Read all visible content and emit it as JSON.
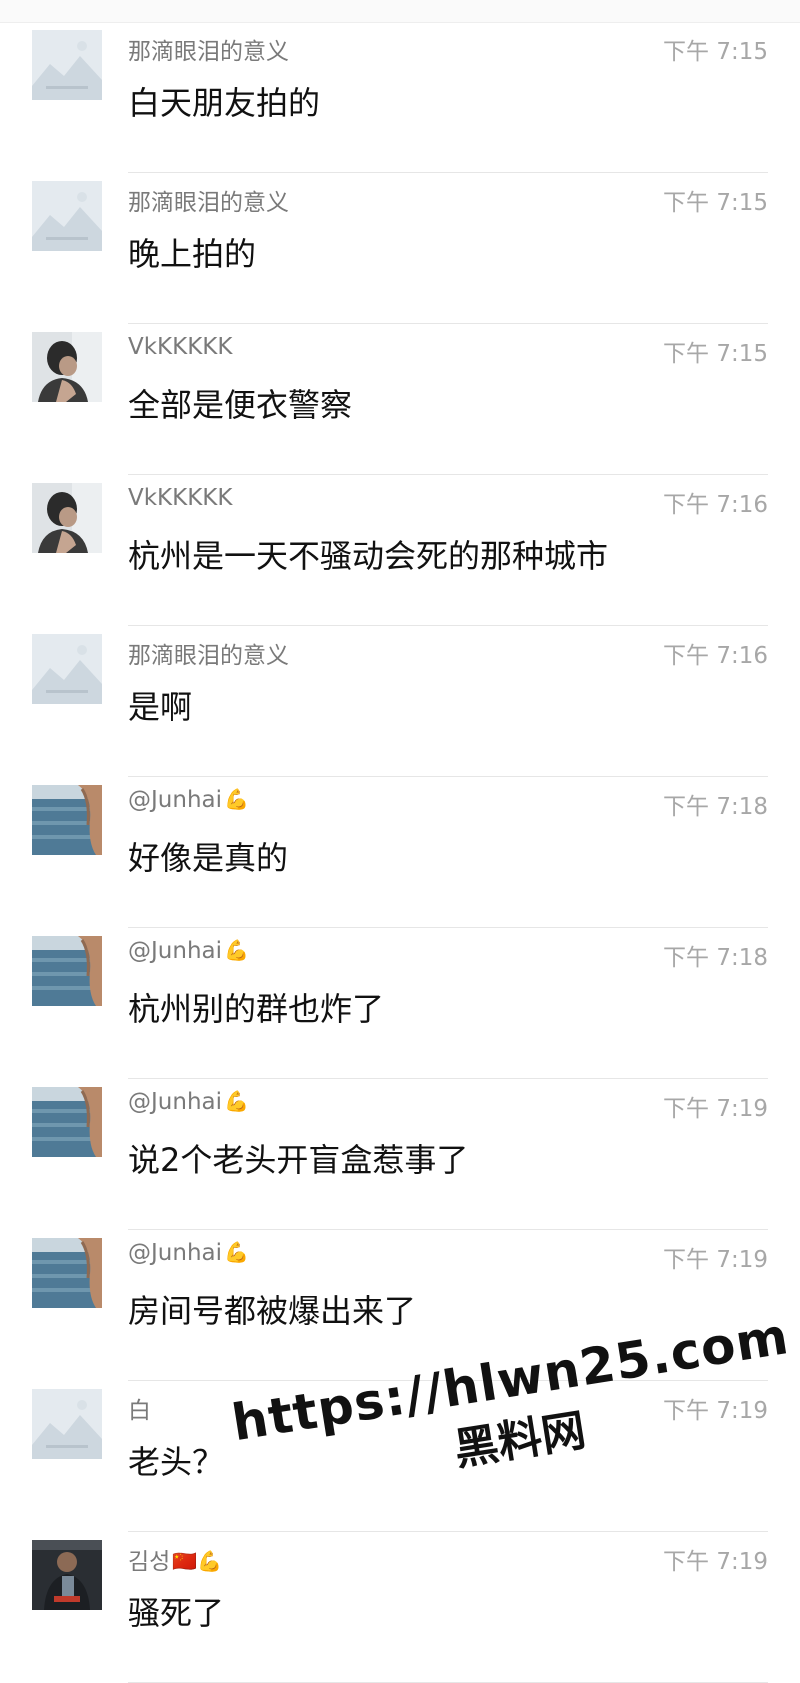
{
  "messages": [
    {
      "sender": "那滴眼泪的意义",
      "badge": "",
      "time": "下午 7:15",
      "text": "白天朋友拍的",
      "avatar": "placeholder-image"
    },
    {
      "sender": "那滴眼泪的意义",
      "badge": "",
      "time": "下午 7:15",
      "text": "晚上拍的",
      "avatar": "placeholder-image"
    },
    {
      "sender": "VkKKKKK",
      "badge": "",
      "time": "下午 7:15",
      "text": "全部是便衣警察",
      "avatar": "person-photo"
    },
    {
      "sender": "VkKKKKK",
      "badge": "",
      "time": "下午 7:16",
      "text": "杭州是一天不骚动会死的那种城市",
      "avatar": "person-photo"
    },
    {
      "sender": "那滴眼泪的意义",
      "badge": "",
      "time": "下午 7:16",
      "text": "是啊",
      "avatar": "placeholder-image"
    },
    {
      "sender": "@Junhai",
      "badge": "💪",
      "time": "下午 7:18",
      "text": "好像是真的",
      "avatar": "sea-photo"
    },
    {
      "sender": "@Junhai",
      "badge": "💪",
      "time": "下午 7:18",
      "text": "杭州别的群也炸了",
      "avatar": "sea-photo"
    },
    {
      "sender": "@Junhai",
      "badge": "💪",
      "time": "下午 7:19",
      "text": "说2个老头开盲盒惹事了",
      "avatar": "sea-photo"
    },
    {
      "sender": "@Junhai",
      "badge": "💪",
      "time": "下午 7:19",
      "text": "房间号都被爆出来了",
      "avatar": "sea-photo"
    },
    {
      "sender": "白",
      "badge": "",
      "time": "下午 7:19",
      "text": "老头？",
      "avatar": "placeholder-image"
    },
    {
      "sender": "김성",
      "badge": "🇨🇳💪",
      "time": "下午 7:19",
      "text": "骚死了",
      "avatar": "gym-photo"
    }
  ],
  "watermark": {
    "url": "https://hlwn25.com",
    "name": "黑料网"
  }
}
